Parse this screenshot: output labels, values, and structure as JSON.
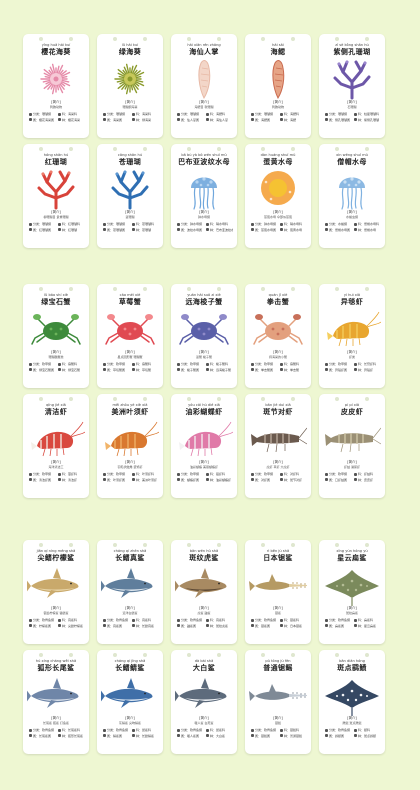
{
  "labels": {
    "intro": "[简介]"
  },
  "sections": [
    {
      "name": "group-1",
      "cards": [
        {
          "pinyin": "yīng huā hǎi kuí",
          "name": "樱花海葵",
          "desc": "刺胞动物",
          "facts": [
            "分类：珊瑚纲",
            "科：海葵科",
            "属：樱花海葵属",
            "种：樱花海葵"
          ],
          "icon": "cherry-anemone-icon",
          "colors": [
            "#e58aa8",
            "#f6c9d6"
          ],
          "kind": "anemone"
        },
        {
          "pinyin": "lǜ hǎi kuí",
          "name": "绿海葵",
          "desc": "珊瑚纲海葵",
          "facts": [
            "分类：珊瑚纲",
            "科：海葵科",
            "属：海葵属",
            "种：绿海葵"
          ],
          "icon": "green-anemone-icon",
          "colors": [
            "#8a9a2b",
            "#c7c85a"
          ],
          "kind": "anemone"
        },
        {
          "pinyin": "hǎi xiān rén zhǎng",
          "name": "海仙人掌",
          "desc": "海鳃目 软珊瑚",
          "facts": [
            "分类：珊瑚纲",
            "科：海鳃科",
            "属：仙人掌属",
            "种：海仙人掌"
          ],
          "icon": "sea-cactus-icon",
          "colors": [
            "#e7b9a6",
            "#f3d6c8"
          ],
          "kind": "pen"
        },
        {
          "pinyin": "hǎi sāi",
          "name": "海鳃",
          "desc": "刺胞动物",
          "facts": [
            "分类：珊瑚纲",
            "科：海鳃科",
            "属：海鳃属",
            "种：海鳃"
          ],
          "icon": "sea-pen-icon",
          "colors": [
            "#c96a4f",
            "#e6a486"
          ],
          "kind": "pen"
        },
        {
          "pinyin": "zǐ sè kǒng shān hú",
          "name": "紫侧孔珊瑚",
          "desc": "石珊瑚",
          "facts": [
            "分类：珊瑚纲",
            "科：柱星珊瑚科",
            "属：侧孔珊瑚属",
            "种：紫侧孔珊瑚"
          ],
          "icon": "purple-coral-icon",
          "colors": [
            "#6d57a8",
            "#9b86cf"
          ],
          "kind": "coral"
        },
        {
          "pinyin": "hóng shān hú",
          "name": "红珊瑚",
          "desc": "柳珊瑚目 贵重珊瑚",
          "facts": [
            "分类：珊瑚纲",
            "科：红珊瑚科",
            "属：红珊瑚属",
            "种：红珊瑚"
          ],
          "icon": "red-coral-icon",
          "colors": [
            "#d8433a",
            "#ee7b6a"
          ],
          "kind": "coral"
        },
        {
          "pinyin": "cāng shān hú",
          "name": "苍珊瑚",
          "desc": "蓝珊瑚",
          "facts": [
            "分类：珊瑚纲",
            "科：苍珊瑚科",
            "属：苍珊瑚属",
            "种：苍珊瑚"
          ],
          "icon": "blue-coral-icon",
          "colors": [
            "#2f6fb3",
            "#5c97d2"
          ],
          "kind": "coral"
        },
        {
          "pinyin": "bā bù yà bō wén shuǐ mǔ",
          "name": "巴布亚波纹水母",
          "desc": "钵水母纲",
          "facts": [
            "分类：钵水母纲",
            "科：硝水母科",
            "属：波纹水母属",
            "种：巴布亚波纹水母"
          ],
          "icon": "spotted-jellyfish-icon",
          "colors": [
            "#6fa6dc",
            "#b6d4f0"
          ],
          "kind": "jelly"
        },
        {
          "pinyin": "dàn huáng shuǐ mǔ",
          "name": "蛋黄水母",
          "desc": "煎蛋水母 伞部似煎蛋",
          "facts": [
            "分类：钵水母纲",
            "科：硝水母科",
            "属：煎蛋水母属",
            "种：蛋黄水母"
          ],
          "icon": "egg-yolk-jellyfish-icon",
          "colors": [
            "#f5c232",
            "#f39b2e"
          ],
          "kind": "egg"
        },
        {
          "pinyin": "xìn wēng shuǐ mǔ",
          "name": "僧帽水母",
          "desc": "水螅虫纲",
          "facts": [
            "分类：水螅纲",
            "科：僧帽水母科",
            "属：僧帽水母属",
            "种：僧帽水母"
          ],
          "icon": "portuguese-man-o-war-icon",
          "colors": [
            "#7fb1e0",
            "#c8dff3"
          ],
          "kind": "jelly"
        }
      ]
    },
    {
      "name": "group-2",
      "cards": [
        {
          "pinyin": "lǜ bǎo shí xiè",
          "name": "绿宝石蟹",
          "desc": "珊瑚礁蟹类",
          "facts": [
            "分类：软甲纲",
            "科：扇蟹科",
            "属：绿宝石蟹属",
            "种：绿宝石蟹"
          ],
          "icon": "emerald-crab-icon",
          "colors": [
            "#3d8a3b",
            "#6bb45a"
          ],
          "kind": "crab"
        },
        {
          "pinyin": "cǎo méi xiè",
          "name": "草莓蟹",
          "desc": "星点圆形蟹 珊瑚蟹",
          "facts": [
            "分类：软甲纲",
            "科：扇蟹科",
            "属：草莓蟹属",
            "种：草莓蟹"
          ],
          "icon": "strawberry-crab-icon",
          "colors": [
            "#e04a52",
            "#f3898d"
          ],
          "kind": "crab"
        },
        {
          "pinyin": "yuǎn hǎi suō zi xiè",
          "name": "远海梭子蟹",
          "desc": "蓝蟹 梭子蟹",
          "facts": [
            "分类：软甲纲",
            "科：梭子蟹科",
            "属：梭子蟹属",
            "种：远海梭子蟹"
          ],
          "icon": "blue-swimming-crab-icon",
          "colors": [
            "#5a5fa8",
            "#8f8ac9"
          ],
          "kind": "crab"
        },
        {
          "pinyin": "quán jī xiè",
          "name": "拳击蟹",
          "desc": "持海葵的小蟹",
          "facts": [
            "分类：软甲纲",
            "科：扇蟹科",
            "属：拳击蟹属",
            "种：拳击蟹"
          ],
          "icon": "boxer-crab-icon",
          "colors": [
            "#e3a07e",
            "#c8705a"
          ],
          "kind": "crab"
        },
        {
          "pinyin": "yì huì xiā",
          "name": "异毯虾",
          "desc": "虾类",
          "facts": [
            "分类：软甲纲",
            "科：长臂虾科",
            "属：异毯虾属",
            "种：异毯虾"
          ],
          "icon": "yellow-shrimp-icon",
          "colors": [
            "#e8a62f",
            "#f5cf5e"
          ],
          "kind": "shrimp"
        },
        {
          "pinyin": "qīng jié xiā",
          "name": "清洁虾",
          "desc": "海洋清洁工",
          "facts": [
            "分类：软甲纲",
            "科：藻虾科",
            "属：清洁虾属",
            "种：清洁虾"
          ],
          "icon": "cleaner-shrimp-icon",
          "colors": [
            "#d9493f",
            "#f4f0e8"
          ],
          "kind": "shrimp"
        },
        {
          "pinyin": "měi zhōu yè xiè xiā",
          "name": "美洲叶须虾",
          "desc": "羽毛状触角 装饰虾",
          "facts": [
            "分类：软甲纲",
            "科：叶须虾科",
            "属：叶须虾属",
            "种：美洲叶须虾"
          ],
          "icon": "feather-shrimp-icon",
          "colors": [
            "#d9782f",
            "#f1b46a"
          ],
          "kind": "shrimp"
        },
        {
          "pinyin": "yóu cǎi hú dié xiā",
          "name": "油彩蝴蝶虾",
          "desc": "油彩蝴蝶 美丽蝴蝶虾",
          "facts": [
            "分类：软甲纲",
            "科：猥虾科",
            "属：蝴蝶虾属",
            "种：油彩蝴蝶虾"
          ],
          "icon": "harlequin-shrimp-icon",
          "colors": [
            "#e07aa8",
            "#f2f2f2"
          ],
          "kind": "shrimp"
        },
        {
          "pinyin": "bān jié duì xiā",
          "name": "斑节对虾",
          "desc": "虎虾 草虾 大虎虾",
          "facts": [
            "分类：软甲纲",
            "科：对虾科",
            "属：对虾属",
            "种：斑节对虾"
          ],
          "icon": "tiger-prawn-icon",
          "colors": [
            "#6b5a4e",
            "#b7a79a"
          ],
          "kind": "prawn"
        },
        {
          "pinyin": "pí pí xiā",
          "name": "皮皮虾",
          "desc": "虾蛄 濑尿虾",
          "facts": [
            "分类：软甲纲",
            "科：虾蛄科",
            "属：口虾蛄属",
            "种：皮皮虾"
          ],
          "icon": "mantis-shrimp-icon",
          "colors": [
            "#9b9075",
            "#cfc6a8"
          ],
          "kind": "prawn"
        }
      ]
    },
    {
      "name": "group-3",
      "cards": [
        {
          "pinyin": "jiān qí níng méng shā",
          "name": "尖鳍柠檬鲨",
          "desc": "锯齿柠檬鲨 镰鳍鲨",
          "facts": [
            "分类：软骨鱼纲",
            "科：真鲨科",
            "属：柠檬鲨属",
            "种：尖鳍柠檬鲨"
          ],
          "icon": "lemon-shark-icon",
          "colors": [
            "#c9a96b",
            "#e6d3a6"
          ],
          "kind": "shark"
        },
        {
          "pinyin": "cháng qí zhēn shā",
          "name": "长鳍真鲨",
          "desc": "远洋白鳍鲨",
          "facts": [
            "分类：软骨鱼纲",
            "科：真鲨科",
            "属：真鲨属",
            "种：长鳍真鲨"
          ],
          "icon": "oceanic-whitetip-icon",
          "colors": [
            "#5f7e9c",
            "#dbe4ec"
          ],
          "kind": "shark"
        },
        {
          "pinyin": "bān wén hǔ shā",
          "name": "斑纹虎鲨",
          "desc": "虎鲨 鼬鲨",
          "facts": [
            "分类：软骨鱼纲",
            "科：真鲨科",
            "属：鼬鲨属",
            "种：斑纹虎鲨"
          ],
          "icon": "tiger-shark-icon",
          "colors": [
            "#a88a62",
            "#5e4a35"
          ],
          "kind": "shark"
        },
        {
          "pinyin": "rì běn jù shā",
          "name": "日本锯鲨",
          "desc": "锯鲨",
          "facts": [
            "分类：软骨鱼纲",
            "科：锯鲨科",
            "属：锯鲨属",
            "种：日本锯鲨"
          ],
          "icon": "sawshark-icon",
          "colors": [
            "#b59a63",
            "#e1cd9f"
          ],
          "kind": "saw"
        },
        {
          "pinyin": "xīng yún hóng yú",
          "name": "星云扁鲨",
          "desc": "斑纹扁鲨",
          "facts": [
            "分类：软骨鱼纲",
            "科：扁鲨科",
            "属：扁鲨属",
            "种：星云扁鲨"
          ],
          "icon": "angel-shark-icon",
          "colors": [
            "#7b8a5c",
            "#b4bd95"
          ],
          "kind": "ray"
        },
        {
          "pinyin": "hú xíng cháng wěi shā",
          "name": "狐形长尾鲨",
          "desc": "长尾鲨 狐鲨 打鱼鲨",
          "facts": [
            "分类：软骨鱼纲",
            "科：长尾鲨科",
            "属：长尾鲨属",
            "种：狐形长尾鲨"
          ],
          "icon": "thresher-shark-icon",
          "colors": [
            "#6f86a8",
            "#d5dde8"
          ],
          "kind": "shark"
        },
        {
          "pinyin": "cháng qí jīng shā",
          "name": "长鳍鲭鲨",
          "desc": "灰鲭鲨 尖吻鲭鲨",
          "facts": [
            "分类：软骨鱼纲",
            "科：鼠鲨科",
            "属：鲭鲨属",
            "种：长鳍鲭鲨"
          ],
          "icon": "mako-shark-icon",
          "colors": [
            "#3f6fa8",
            "#d9e4f0"
          ],
          "kind": "shark"
        },
        {
          "pinyin": "dà bái shā",
          "name": "大白鲨",
          "desc": "噬人鲨 白死鲨",
          "facts": [
            "分类：软骨鱼纲",
            "科：鼠鲨科",
            "属：噬人鲨属",
            "种：大白鲨"
          ],
          "icon": "great-white-shark-icon",
          "colors": [
            "#5d6b7c",
            "#eef1f4"
          ],
          "kind": "shark"
        },
        {
          "pinyin": "pǔ tōng jù fèn",
          "name": "普通锯鳐",
          "desc": "锯鳐",
          "facts": [
            "分类：软骨鱼纲",
            "科：锯鳐科",
            "属：锯鳐属",
            "种：普通锯鳐"
          ],
          "icon": "sawfish-icon",
          "colors": [
            "#7f8a96",
            "#c7ced6"
          ],
          "kind": "saw"
        },
        {
          "pinyin": "bān diǎn hóng",
          "name": "斑点鹞鲼",
          "desc": "鹰鳐 斑点鹰鳐",
          "facts": [
            "分类：软骨鱼纲",
            "科：鲼科",
            "属：鹞鲼属",
            "种：斑点鹞鲼"
          ],
          "icon": "spotted-eagle-ray-icon",
          "colors": [
            "#354863",
            "#f2f4f7"
          ],
          "kind": "ray"
        }
      ]
    }
  ]
}
